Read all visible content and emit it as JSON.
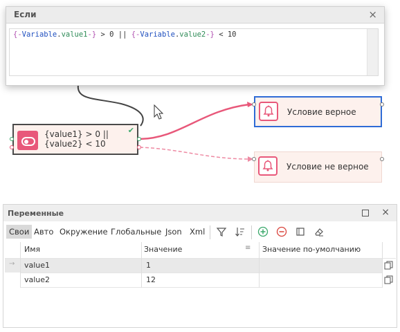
{
  "condition_window": {
    "title": "Если",
    "close_icon": "×",
    "expression_tokens": [
      {
        "t": "{-",
        "c": "brace"
      },
      {
        "t": "Variable",
        "c": "ns"
      },
      {
        "t": ".",
        "c": "dot"
      },
      {
        "t": "value1",
        "c": "var"
      },
      {
        "t": "-}",
        "c": "brace"
      },
      {
        "t": " > 0 || ",
        "c": "op"
      },
      {
        "t": "{-",
        "c": "brace"
      },
      {
        "t": "Variable",
        "c": "ns"
      },
      {
        "t": ".",
        "c": "dot"
      },
      {
        "t": "value2",
        "c": "var"
      },
      {
        "t": "-}",
        "c": "brace"
      },
      {
        "t": " < 10",
        "c": "op"
      }
    ]
  },
  "canvas": {
    "if_node": {
      "line1": "{value1} > 0 ||",
      "line2": "{value2} < 10",
      "check_icon": "✔"
    },
    "true_node": {
      "label": "Условие верное"
    },
    "false_node": {
      "label": "Условие не верное"
    },
    "colors": {
      "accent": "#e8587a",
      "selected_border": "#2e6bd6",
      "true_wire": "#e8587a",
      "false_wire": "#ee8aa3",
      "link_wire": "#444444"
    }
  },
  "variables_panel": {
    "title": "Переменные",
    "tabs": [
      "Свои",
      "Авто",
      "Окружение",
      "Глобальные",
      "Json",
      "Xml"
    ],
    "active_tab": "Свои",
    "toolbar_icons": [
      "filter-icon",
      "sort-icon",
      "add-icon",
      "remove-icon",
      "clear-icon",
      "eraser-icon"
    ],
    "columns": [
      "Имя",
      "Значение",
      "Значение по-умолчанию"
    ],
    "rows": [
      {
        "name": "value1",
        "value": "1",
        "default": ""
      },
      {
        "name": "value2",
        "value": "12",
        "default": ""
      }
    ],
    "row_arrow": "→"
  }
}
